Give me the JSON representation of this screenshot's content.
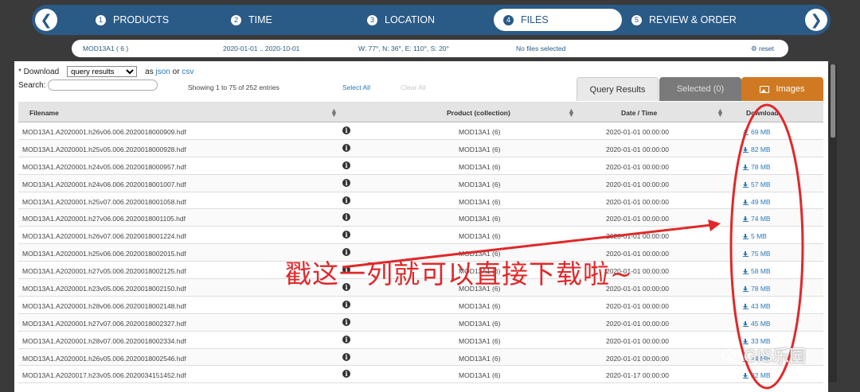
{
  "stepbar": {
    "back_icon": "arrow-left-icon",
    "next_icon": "arrow-right-icon",
    "steps": [
      {
        "num": "1",
        "label": "PRODUCTS"
      },
      {
        "num": "2",
        "label": "TIME"
      },
      {
        "num": "3",
        "label": "LOCATION"
      },
      {
        "num": "4",
        "label": "FILES"
      },
      {
        "num": "5",
        "label": "REVIEW & ORDER"
      }
    ],
    "active_step": "FILES"
  },
  "summary": {
    "product": "MOD13A1 ( 6 )",
    "time_range": "2020-01-01 .. 2020-10-01",
    "bbox": "W: 77°, N: 36°, E: 110°, S: 20°",
    "selection": "No files selected",
    "reset_label": "reset",
    "reset_icon": "gears-icon"
  },
  "toolbar": {
    "download_label": "* Download",
    "download_select": "query results",
    "as_label": "as",
    "json_label": "json",
    "or_label": "or",
    "csv_label": "csv",
    "search_label": "Search:",
    "search_value": "",
    "showing": "Showing 1 to 75 of 252 entries",
    "select_all": "Select All",
    "clear_all": "Clear All"
  },
  "tabs": {
    "query": "Query Results",
    "selected": "Selected (0)",
    "images": "Images",
    "images_icon": "image-icon"
  },
  "table": {
    "columns": [
      "Filename",
      "Product (collection)",
      "Date / Time",
      "Download"
    ],
    "rows": [
      {
        "file": "MOD13A1.A2020001.h26v06.006.2020018000909.hdf",
        "product": "MOD13A1 (6)",
        "date": "2020-01-01 00:00:00",
        "size": "69 MB"
      },
      {
        "file": "MOD13A1.A2020001.h25v05.006.2020018000928.hdf",
        "product": "MOD13A1 (6)",
        "date": "2020-01-01 00:00:00",
        "size": "82 MB"
      },
      {
        "file": "MOD13A1.A2020001.h24v05.006.2020018000957.hdf",
        "product": "MOD13A1 (6)",
        "date": "2020-01-01 00:00:00",
        "size": "78 MB"
      },
      {
        "file": "MOD13A1.A2020001.h24v06.006.2020018001007.hdf",
        "product": "MOD13A1 (6)",
        "date": "2020-01-01 00:00:00",
        "size": "57 MB"
      },
      {
        "file": "MOD13A1.A2020001.h25v07.006.2020018001058.hdf",
        "product": "MOD13A1 (6)",
        "date": "2020-01-01 00:00:00",
        "size": "49 MB"
      },
      {
        "file": "MOD13A1.A2020001.h27v06.006.2020018001105.hdf",
        "product": "MOD13A1 (6)",
        "date": "2020-01-01 00:00:00",
        "size": "74 MB"
      },
      {
        "file": "MOD13A1.A2020001.h26v07.006.2020018001224.hdf",
        "product": "MOD13A1 (6)",
        "date": "2020-01-01 00:00:00",
        "size": "5 MB"
      },
      {
        "file": "MOD13A1.A2020001.h25v06.006.2020018002015.hdf",
        "product": "MOD13A1 (6)",
        "date": "2020-01-01 00:00:00",
        "size": "75 MB"
      },
      {
        "file": "MOD13A1.A2020001.h27v05.006.2020018002125.hdf",
        "product": "MOD13A1 (6)",
        "date": "2020-01-01 00:00:00",
        "size": "58 MB"
      },
      {
        "file": "MOD13A1.A2020001.h23v05.006.2020018002150.hdf",
        "product": "MOD13A1 (6)",
        "date": "2020-01-01 00:00:00",
        "size": "78 MB"
      },
      {
        "file": "MOD13A1.A2020001.h28v06.006.2020018002148.hdf",
        "product": "MOD13A1 (6)",
        "date": "2020-01-01 00:00:00",
        "size": "43 MB"
      },
      {
        "file": "MOD13A1.A2020001.h27v07.006.2020018002327.hdf",
        "product": "MOD13A1 (6)",
        "date": "2020-01-01 00:00:00",
        "size": "45 MB"
      },
      {
        "file": "MOD13A1.A2020001.h28v07.006.2020018002334.hdf",
        "product": "MOD13A1 (6)",
        "date": "2020-01-01 00:00:00",
        "size": "33 MB"
      },
      {
        "file": "MOD13A1.A2020001.h26v05.006.2020018002546.hdf",
        "product": "MOD13A1 (6)",
        "date": "2020-01-01 00:00:00",
        "size": "24 MB"
      },
      {
        "file": "MOD13A1.A2020017.h23v05.006.2020034151452.hdf",
        "product": "MOD13A1 (6)",
        "date": "2020-01-17 00:00:00",
        "size": "82 MB"
      }
    ],
    "info_icon": "info-circle-icon",
    "download_icon": "download-icon"
  },
  "annotation": {
    "text": "戳这一列就可以直接下载啦~",
    "color": "#e0282a"
  },
  "watermark": {
    "text": "GIS乐园",
    "icon": "wechat-icon"
  },
  "colors": {
    "stepbar": "#2a5a86",
    "accent_orange": "#cf7a22",
    "link": "#2a7ab8"
  }
}
